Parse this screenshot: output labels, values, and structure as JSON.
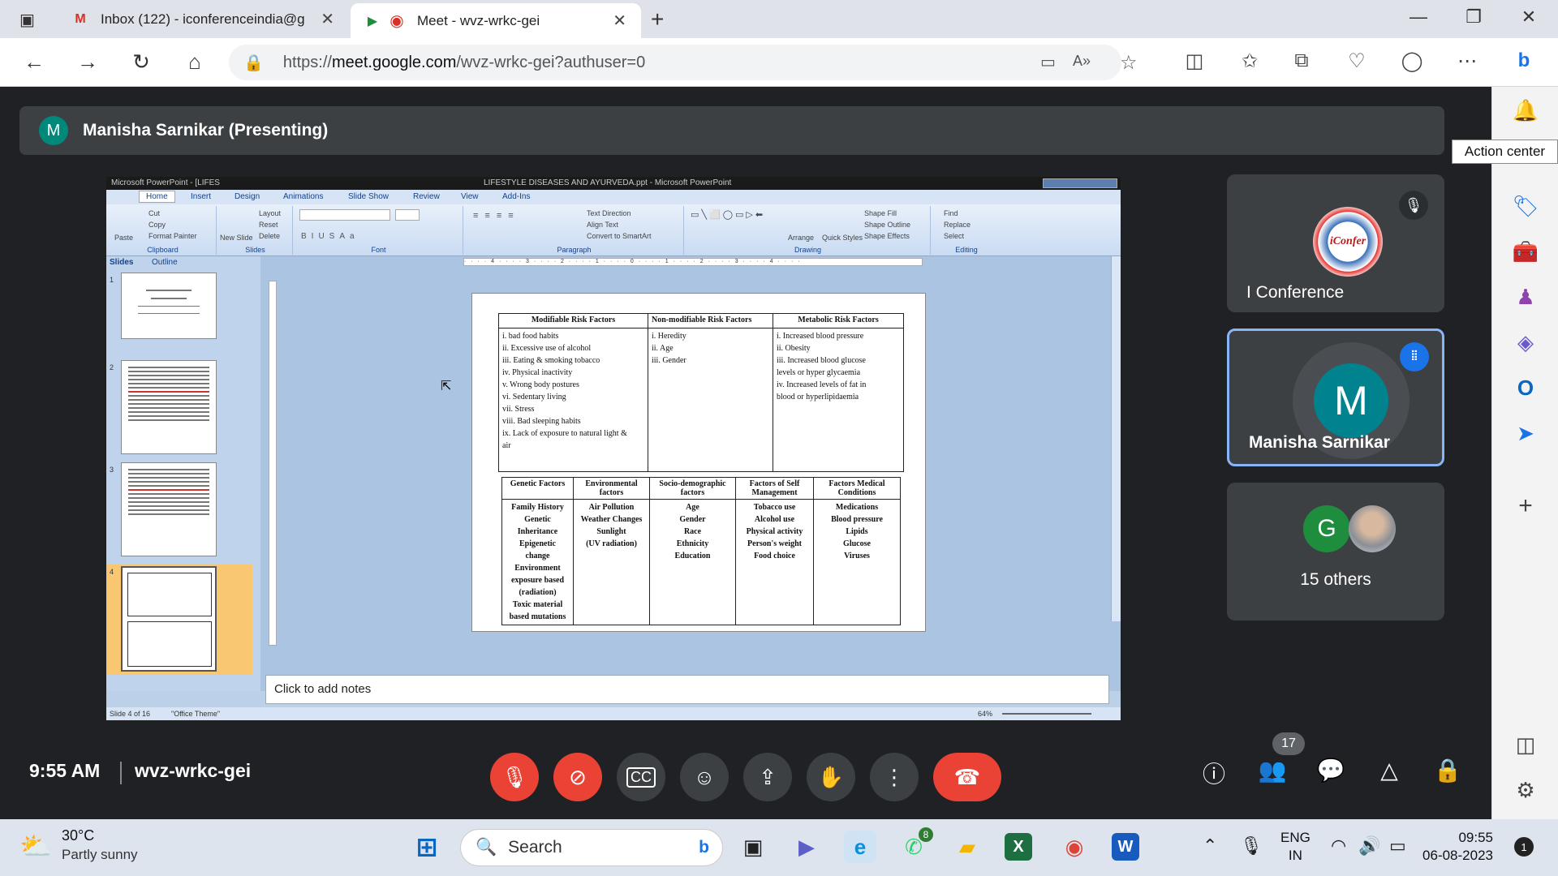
{
  "browser": {
    "tabs": [
      {
        "title": "Inbox (122) - iconferenceindia@g",
        "favicon": "gmail-icon"
      },
      {
        "title": "Meet - wvz-wrkc-gei",
        "favicon": "meet-icon"
      }
    ],
    "url_prefix": "https://",
    "url_host": "meet.google.com",
    "url_path": "/wvz-wrkc-gei?authuser=0"
  },
  "meet": {
    "presenter_initial": "M",
    "presenter_label": "Manisha Sarnikar (Presenting)",
    "tooltip": "Action center",
    "tiles": [
      {
        "name": "I Conference",
        "logo_text": "iConfer",
        "muted": true
      },
      {
        "name": "Manisha Sarnikar",
        "initial": "M",
        "speaking": true
      },
      {
        "name": "15 others",
        "initial": "G"
      }
    ],
    "clock": "9:55 AM",
    "meeting_code": "wvz-wrkc-gei",
    "participant_count": "17"
  },
  "powerpoint": {
    "window_title_left": "Microsoft PowerPoint - [LIFES",
    "window_title_center": "LIFESTYLE DISEASES AND AYURVEDA.ppt - Microsoft PowerPoint",
    "ribbon_tabs": [
      "Home",
      "Insert",
      "Design",
      "Animations",
      "Slide Show",
      "Review",
      "View",
      "Add-Ins"
    ],
    "ribbon_groups": [
      "Clipboard",
      "Slides",
      "Font",
      "Paragraph",
      "Drawing",
      "Editing"
    ],
    "clipboard_cmds": [
      "Cut",
      "Copy",
      "Format Painter",
      "Paste"
    ],
    "slides_cmds": [
      "Layout",
      "Reset",
      "Delete",
      "New Slide"
    ],
    "paragraph_cmds": [
      "Text Direction",
      "Align Text",
      "Convert to SmartArt"
    ],
    "drawing_cmds": [
      "Shape Fill",
      "Shape Outline",
      "Shape Effects",
      "Arrange",
      "Quick Styles"
    ],
    "editing_cmds": [
      "Find",
      "Replace",
      "Select"
    ],
    "panel_tabs": [
      "Slides",
      "Outline"
    ],
    "thumb_numbers": [
      "1",
      "2",
      "3",
      "4"
    ],
    "notes_placeholder": "Click to add notes",
    "status_slide": "Slide 4 of 16",
    "status_theme": "\"Office Theme\"",
    "zoom": "64%"
  },
  "slide": {
    "table1": {
      "headers": [
        "Modifiable Risk Factors",
        "Non-modifiable Risk Factors",
        "Metabolic Risk Factors"
      ],
      "modifiable": [
        "i.   bad food habits",
        "ii.  Excessive use of alcohol",
        "iii. Eating & smoking tobacco",
        "iv.  Physical inactivity",
        "v.   Wrong body postures",
        "vi.  Sedentary living",
        "vii. Stress",
        "viii. Bad sleeping habits",
        "ix.  Lack of exposure to natural light &",
        "      air"
      ],
      "non_modifiable": [
        "i.   Heredity",
        "ii.  Age",
        "iii. Gender"
      ],
      "metabolic": [
        "i.   Increased blood pressure",
        "ii.  Obesity",
        "iii. Increased blood glucose",
        "      levels or hyper glycaemia",
        "iv.  Increased levels of fat in",
        "      blood or hyperlipidaemia"
      ]
    },
    "table2": {
      "headers": [
        "Genetic Factors",
        "Environmental factors",
        "Socio-demographic factors",
        "Factors of Self Management",
        "Factors Medical Conditions"
      ],
      "genetic": [
        "Family History",
        "Genetic",
        "Inheritance",
        "Epigenetic",
        "change",
        "Environment",
        "exposure based",
        "(radiation)",
        "Toxic material",
        "based mutations"
      ],
      "environmental": [
        "Air Pollution",
        "Weather Changes",
        "Sunlight",
        "(UV radiation)"
      ],
      "socio": [
        "Age",
        "Gender",
        "Race",
        "Ethnicity",
        "Education"
      ],
      "self_mgmt": [
        "Tobacco use",
        "Alcohol use",
        "Physical activity",
        "Person's weight",
        "Food choice"
      ],
      "medical": [
        "Medications",
        "Blood pressure",
        "Lipids",
        "Glucose",
        "Viruses"
      ]
    }
  },
  "taskbar": {
    "weather_temp": "30°C",
    "weather_desc": "Partly sunny",
    "search_placeholder": "Search",
    "whatsapp_badge": "8",
    "lang_top": "ENG",
    "lang_bottom": "IN",
    "time": "09:55",
    "date": "06-08-2023",
    "notification_count": "1"
  }
}
